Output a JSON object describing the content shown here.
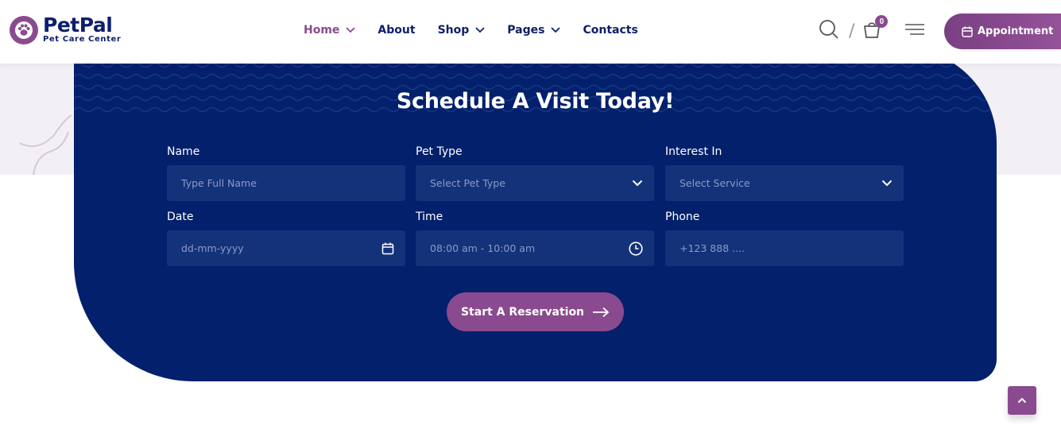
{
  "brand": {
    "name": "PetPal",
    "tagline": "Pet Care Center"
  },
  "nav": {
    "items": [
      {
        "label": "Home",
        "dropdown": true,
        "active": true
      },
      {
        "label": "About",
        "dropdown": false,
        "active": false
      },
      {
        "label": "Shop",
        "dropdown": true,
        "active": false
      },
      {
        "label": "Pages",
        "dropdown": true,
        "active": false
      },
      {
        "label": "Contacts",
        "dropdown": false,
        "active": false
      }
    ]
  },
  "header": {
    "divider": "/",
    "cart_count": "0",
    "appointment_label": "Appointment"
  },
  "form": {
    "title": "Schedule A Visit Today!",
    "name": {
      "label": "Name",
      "placeholder": "Type Full Name"
    },
    "pet_type": {
      "label": "Pet Type",
      "selected": "Select Pet Type"
    },
    "interest": {
      "label": "Interest In",
      "selected": "Select Service"
    },
    "date": {
      "label": "Date",
      "placeholder": "dd-mm-yyyy"
    },
    "time": {
      "label": "Time",
      "value": "08:00 am - 10:00 am"
    },
    "phone": {
      "label": "Phone",
      "placeholder": "+123 888 ...."
    },
    "submit_label": "Start A Reservation"
  },
  "colors": {
    "primary": "#8a4a8f",
    "navy": "#02206b",
    "field": "#14327a",
    "band": "#f3f0f5"
  },
  "icons": [
    "paw-icon",
    "chevron-down-icon",
    "search-icon",
    "cart-icon",
    "menu-icon",
    "calendar-icon",
    "clock-icon",
    "arrow-right-icon",
    "arrow-up-icon"
  ]
}
